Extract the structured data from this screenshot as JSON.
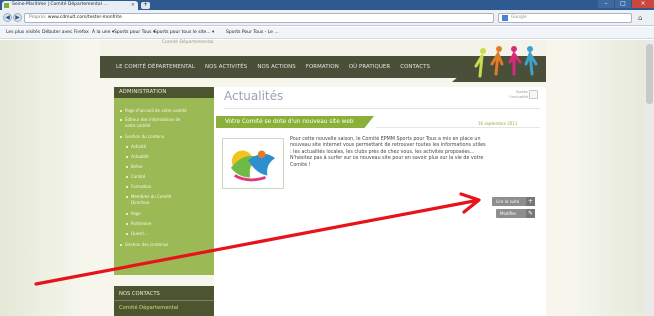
{
  "browser": {
    "tab_title": "Seine-Maritime | Comité Départemental ...",
    "new_tab_symbol": "+",
    "url_prefix": "Proprio: ",
    "url_main": "www.cdmult.com/tester-monfrite",
    "search_placeholder": "Google",
    "bookmarks": [
      "Les plus visités",
      "Débuter avec Firefox",
      "À la une ▾",
      "Sports pour Tous ▾",
      "Sports pour tous le site... ▾",
      "Sports Pour Tous - Le ..."
    ]
  },
  "site": {
    "top_text": "Comité Départemental",
    "menu": [
      "LE COMITÉ DÉPARTEMENTAL",
      "NOS ACTIVITÉS",
      "NOS ACTIONS",
      "FORMATION",
      "OÙ PRATIQUER",
      "CONTACTS"
    ],
    "sidebar": {
      "title": "ADMINISTRATION",
      "items": [
        {
          "label": "Page d'accueil de votre comité",
          "level": 1
        },
        {
          "label": "Éditeur des informations de",
          "level": 1
        },
        {
          "label": "votre comité",
          "level": 1,
          "continuation": true
        },
        {
          "label": "Gestion du contenu",
          "level": 1
        },
        {
          "label": "Activité",
          "level": 2
        },
        {
          "label": "Actualité",
          "level": 2
        },
        {
          "label": "Brève",
          "level": 2
        },
        {
          "label": "Comité",
          "level": 2
        },
        {
          "label": "Formation",
          "level": 2
        },
        {
          "label": "Membres du Comité",
          "level": 2
        },
        {
          "label": "Directeur",
          "level": 2,
          "continuation": true
        },
        {
          "label": "Page",
          "level": 2
        },
        {
          "label": "Partenaire",
          "level": 2
        },
        {
          "label": "Questi...",
          "level": 2
        },
        {
          "label": "Gestion des contenus",
          "level": 1
        }
      ]
    },
    "contacts": {
      "title": "NOS CONTACTS",
      "name": "Comité Départemental"
    },
    "main": {
      "page_title": "Actualités",
      "print_label_1": "Toutes",
      "print_label_2": "l'actualité",
      "article": {
        "title": "Votre Comité se dote d'un nouveau site web",
        "date": "16 septembre 2011",
        "body_lines": [
          "Pour cette nouvelle saison, le Comité EPMM Sports pour Tous a mis en place un",
          "nouveau site internet vous permettant de retrouver toutes les informations utiles",
          ": les actualités locales, les clubs près de chez vous, les activités proposées...",
          "N'hésitez pas à surfer sur ce nouveau site pour en savoir plus sur la vie de votre",
          "Comité !"
        ],
        "read_more": "Lire la suite",
        "edit": "Modifier"
      }
    }
  },
  "colors": {
    "menu_bg": "#4a4f3a",
    "sidebar_green": "#9bb955",
    "accent_green": "#8bb03a",
    "annotation_red": "#e8131a"
  }
}
